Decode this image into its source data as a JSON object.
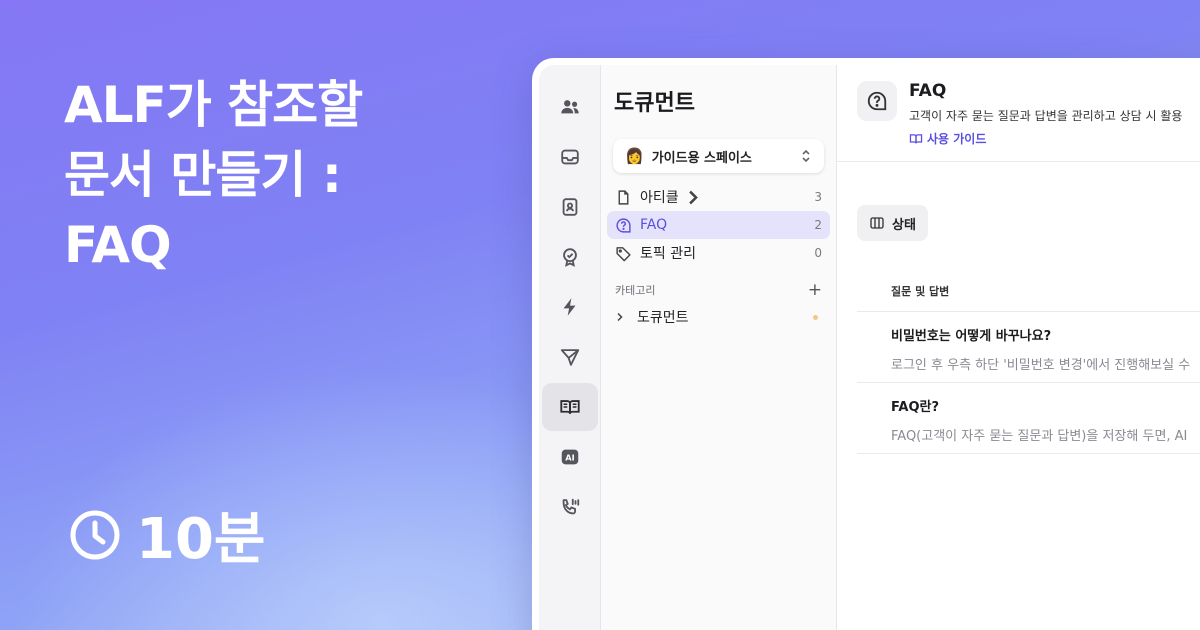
{
  "hero": {
    "title_lines": [
      "ALF가 참조할",
      "문서 만들기 :",
      "FAQ"
    ],
    "duration": "10분"
  },
  "rail": {
    "items": [
      {
        "icon": "users-icon"
      },
      {
        "icon": "inbox-icon"
      },
      {
        "icon": "contact-card-icon"
      },
      {
        "icon": "badge-check-icon"
      },
      {
        "icon": "lightning-icon"
      },
      {
        "icon": "send-icon"
      },
      {
        "icon": "book-open-icon",
        "active": true
      },
      {
        "icon": "ai-icon",
        "text": "AI"
      },
      {
        "icon": "phone-call-icon"
      }
    ]
  },
  "sidebar": {
    "title": "도큐먼트",
    "space": {
      "emoji": "👩",
      "name": "가이드용 스페이스"
    },
    "items": [
      {
        "label": "아티클",
        "count": "3",
        "icon": "document-icon"
      },
      {
        "label": "FAQ",
        "count": "2",
        "icon": "question-bubble-icon",
        "active": true
      },
      {
        "label": "토픽 관리",
        "count": "0",
        "icon": "tag-icon"
      }
    ],
    "category_section": {
      "label": "카테고리",
      "plus": "+"
    },
    "categories": [
      {
        "label": "도큐먼트"
      }
    ]
  },
  "main": {
    "title": "FAQ",
    "description": "고객이 자주 묻는 질문과 답변을 관리하고 상담 시 활용",
    "guide_link": "사용 가이드",
    "status_button": "상태",
    "table": {
      "header": "질문 및 답변",
      "rows": [
        {
          "question": "비밀번호는 어떻게 바꾸나요?",
          "answer": "로그인 후 우측 하단 '비밀번호 변경'에서 진행해보실 수"
        },
        {
          "question": "FAQ란?",
          "answer": "FAQ(고객이 자주 묻는 질문과 답변)을 저장해 두면, AI"
        }
      ]
    }
  },
  "colors": {
    "accent": "#5b4fe0",
    "active_bg": "#e5e3fb",
    "dot": "#f6c58d"
  }
}
